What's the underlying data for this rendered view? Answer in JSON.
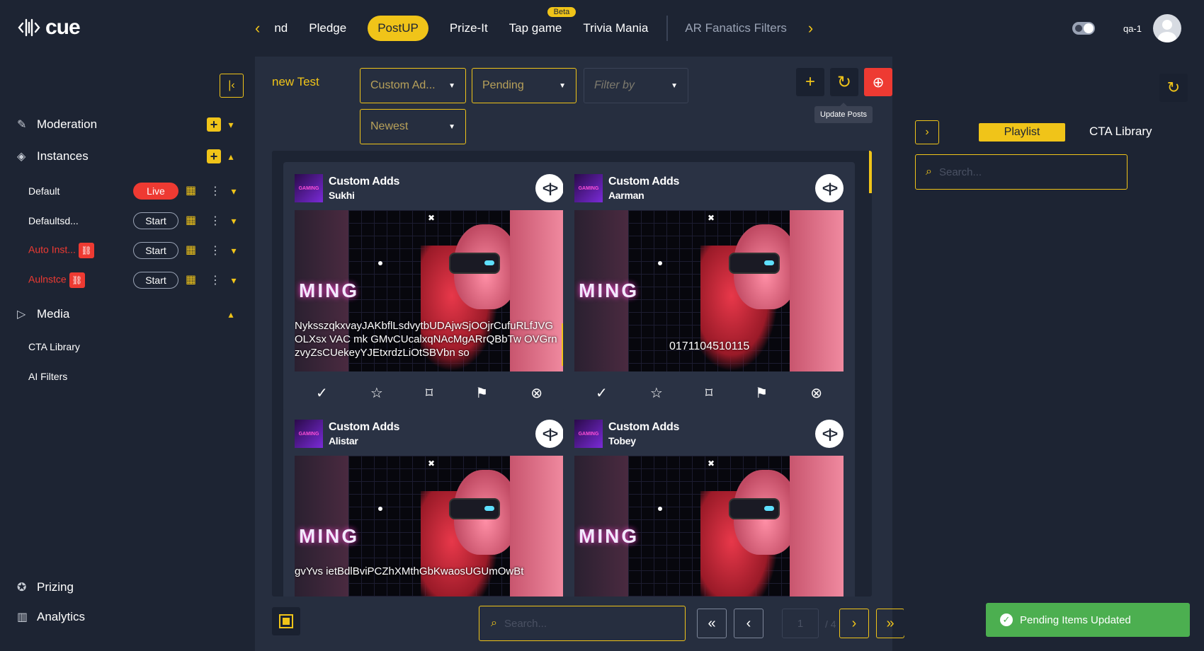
{
  "app": {
    "logo": "cue"
  },
  "topnav": {
    "tabs": [
      {
        "label": "nd"
      },
      {
        "label": "Pledge"
      },
      {
        "label": "PostUP",
        "active": true
      },
      {
        "label": "Prize-It"
      },
      {
        "label": "Tap game",
        "badge": "Beta"
      },
      {
        "label": "Trivia Mania"
      }
    ],
    "extra_tab": "AR Fanatics Filters",
    "username": "qa-1"
  },
  "sidebar": {
    "moderation": "Moderation",
    "instances": "Instances",
    "instance_items": [
      {
        "label": "Default",
        "status": "Live",
        "error": false
      },
      {
        "label": "Defaultsd...",
        "status": "Start",
        "error": false
      },
      {
        "label": "Auto Inst...",
        "status": "Start",
        "error": true
      },
      {
        "label": "Aulnstce",
        "status": "Start",
        "error": true
      }
    ],
    "media": "Media",
    "media_items": [
      "CTA Library",
      "AI Filters"
    ],
    "prizing": "Prizing",
    "analytics": "Analytics"
  },
  "toolbar": {
    "view_name": "new Test",
    "filter_type": "Custom Ad...",
    "filter_status": "Pending",
    "filter_by_placeholder": "Filter by",
    "sort": "Newest",
    "tooltip": "Update Posts"
  },
  "posts": [
    {
      "title": "Custom Adds",
      "user": "Sukhi",
      "caption": "NyksszqkxvayJAKbflLsdvytbUDAjwSjOOjrCufuRLfJVGOLXsx VAC mk GMvCUcalxqNAcMgARrQBbTw OVGrnzvyZsCUekeyYJEtxrdzLiOtSBVbn so",
      "code": ""
    },
    {
      "title": "Custom Adds",
      "user": "Aarman",
      "caption": "",
      "code": "0171104510115"
    },
    {
      "title": "Custom Adds",
      "user": "Alistar",
      "caption": "gvYvs ietBdlBviPCZhXMthGbKwaosUGUmOwBt",
      "code": ""
    },
    {
      "title": "Custom Adds",
      "user": "Tobey",
      "caption": "",
      "code": ""
    }
  ],
  "media_graphic": {
    "word": "MING",
    "brand_thumb": "GAMING"
  },
  "pagination": {
    "search_placeholder": "Search...",
    "page": "1",
    "total": "/ 4"
  },
  "right_panel": {
    "tab_active": "Playlist",
    "tab_other": "CTA Library",
    "search_placeholder": "Search..."
  },
  "toast": {
    "message": "Pending Items Updated"
  },
  "colors": {
    "accent": "#f0c419",
    "live": "#ee3a32",
    "success": "#4caf50",
    "bg": "#1d2433"
  }
}
